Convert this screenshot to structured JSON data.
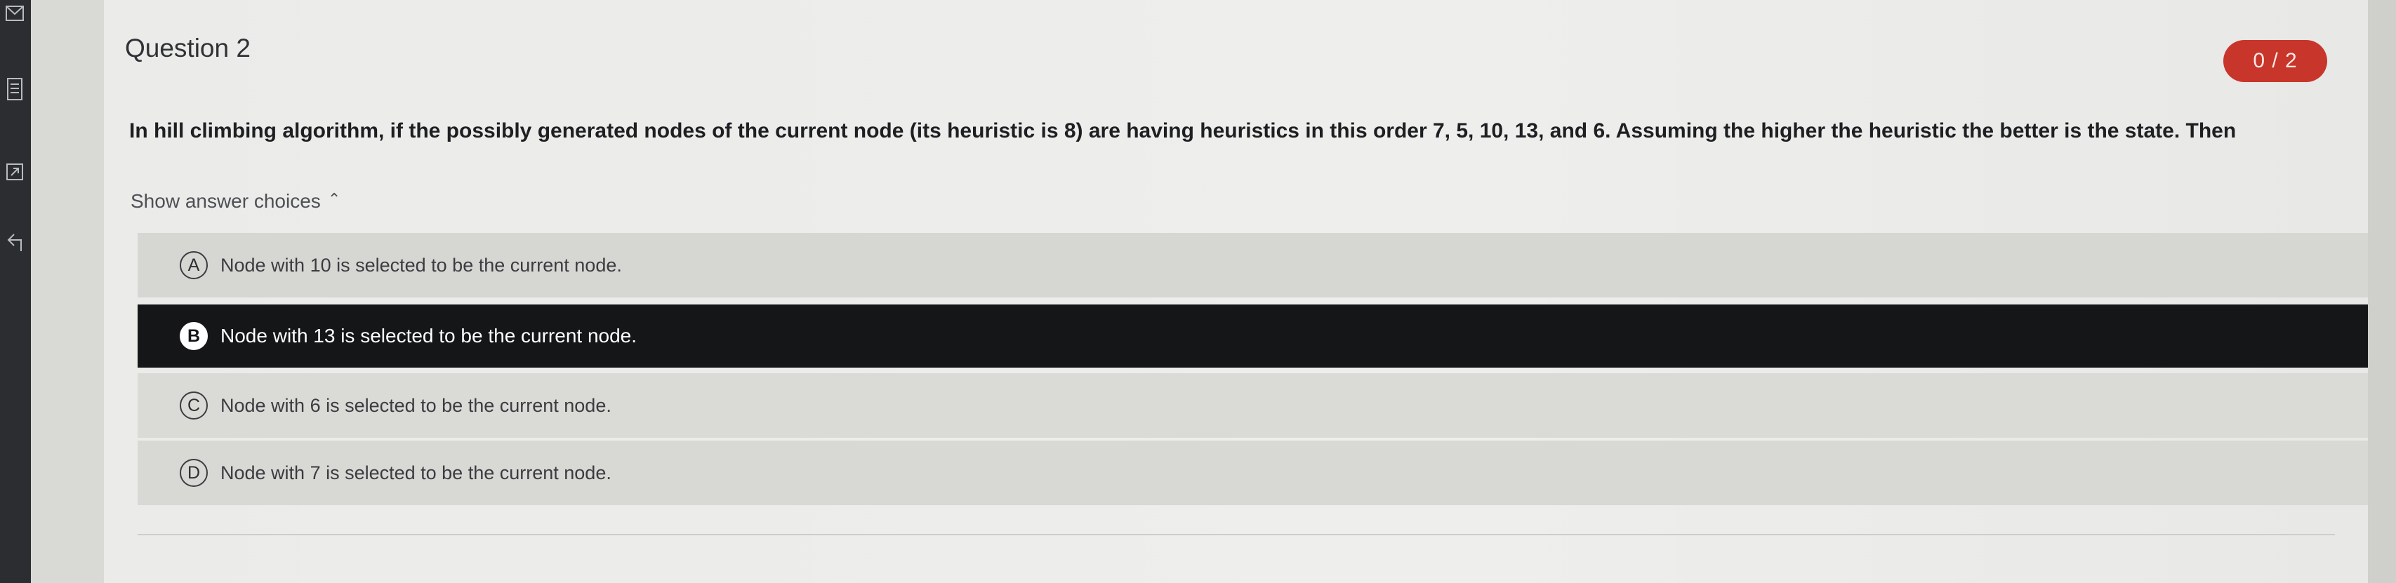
{
  "question": {
    "title": "Question 2",
    "score": "0 / 2",
    "text": "In hill climbing algorithm, if the possibly generated nodes of the current node (its heuristic is 8) are having heuristics in this order 7, 5, 10, 13, and 6. Assuming the higher the heuristic the better is the state. Then",
    "toggle_label": "Show answer choices",
    "choices": [
      {
        "letter": "A",
        "text": "Node with 10 is selected to be the current node."
      },
      {
        "letter": "B",
        "text": "Node with 13 is selected to be the current node.",
        "selected": true
      },
      {
        "letter": "C",
        "text": "Node with 6 is selected to be the current node."
      },
      {
        "letter": "D",
        "text": "Node with 7 is selected to be the current node."
      }
    ]
  },
  "colors": {
    "score_badge": "#c8352a",
    "selected_choice": "#151618",
    "rail": "#2b2d30"
  },
  "icons": [
    "mail-icon",
    "document-icon",
    "external-icon",
    "back-icon",
    "chevron-up-icon"
  ]
}
